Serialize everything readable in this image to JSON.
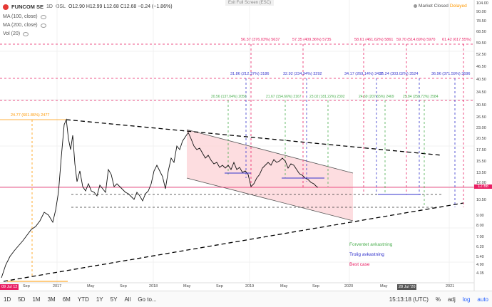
{
  "header": {
    "symbol": "FUNCOM SE",
    "interval": "1D",
    "exchange": "OSL",
    "ohlc": "O12.90 H12.99 L12.68 C12.68 −0.24 (−1.86%)",
    "exit_fullscreen": "Exit Full Screen (ESC)",
    "market_status": "Market Closed",
    "delayed": "Delayed"
  },
  "indicators": [
    {
      "label": "MA (100, close)"
    },
    {
      "label": "MA (200, close)"
    },
    {
      "label": "Vol (20)"
    }
  ],
  "price_axis": {
    "ticks": [
      "104.00",
      "90.00",
      "78.50",
      "68.50",
      "59.50",
      "52.50",
      "46.50",
      "40.50",
      "34.50",
      "30.50",
      "26.50",
      "23.00",
      "20.50",
      "17.50",
      "15.50",
      "13.50",
      "12.00",
      "10.50",
      "9.00",
      "8.00",
      "7.00",
      "6.20",
      "5.40",
      "4.90",
      "4.35"
    ],
    "current_price": "12.68"
  },
  "time_axis": {
    "ticks": [
      "Sep",
      "2017",
      "May",
      "Sep",
      "2018",
      "May",
      "Sep",
      "2019",
      "May",
      "Sep",
      "2020",
      "May",
      "2021"
    ],
    "start_label": "09 Jul 12",
    "cursor_label": "28 Jul '20"
  },
  "annotations": {
    "best_case": [
      "56.37 (376.03%) 5637",
      "57.35 (409.36%) 5735",
      "58.61 (461.62%) 5861",
      "59.70 (514.69%) 5970",
      "61.42 (617.55%)"
    ],
    "likely": [
      "31.86 (212.37%) 3186",
      "32.92 (234.94%) 3292",
      "34.17 (269.14%) 3417",
      "35.24 (303.02%) 3524",
      "36.96 (371.59%) 3696"
    ],
    "expected": [
      "20.56 (137.04%) 2056",
      "21.67 (154.66%) 2167",
      "23.02 (181.22%) 2302",
      "24.69 (207.65%) 2469",
      "25.84 (259.72%) 2584"
    ],
    "peak": "24.77 (601.86%) 2477"
  },
  "legend_labels": {
    "expected": "Forventet avkastning",
    "likely": "Trolig avkastning",
    "best": "Best case"
  },
  "colors": {
    "expected": "#4caf50",
    "likely": "#3333cc",
    "best": "#e91e63",
    "peak": "#ff9800",
    "channel": "#fcd4d8"
  },
  "toolbar": {
    "ranges": [
      "1D",
      "5D",
      "1M",
      "3M",
      "6M",
      "YTD",
      "1Y",
      "5Y",
      "All"
    ],
    "goto": "Go to...",
    "time": "15:13:18 (UTC)",
    "pct": "%",
    "adj": "adj",
    "log": "log",
    "auto": "auto"
  }
}
